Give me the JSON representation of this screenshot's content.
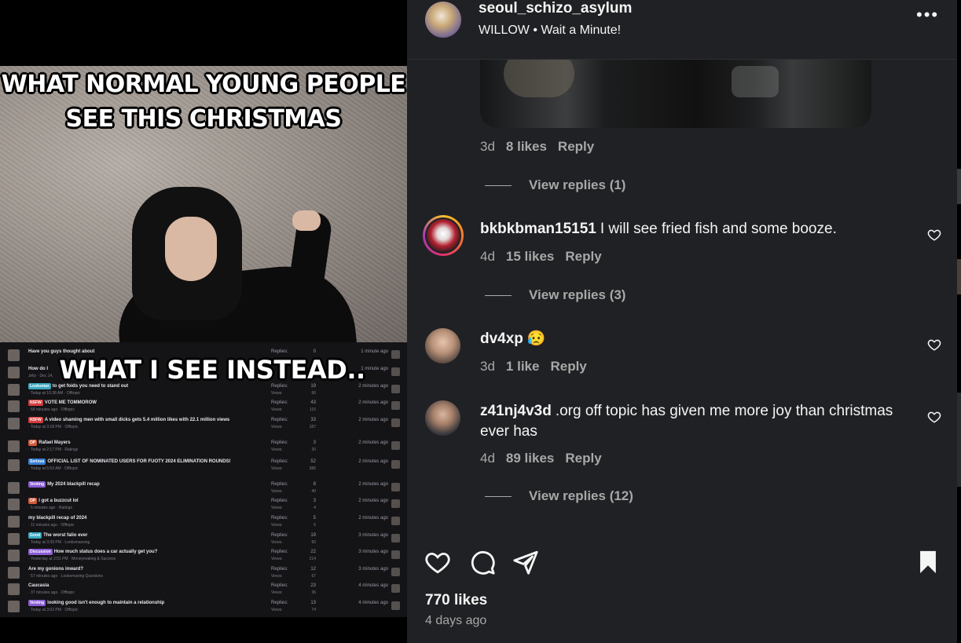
{
  "media": {
    "meme_top_line1": "WHAT NORMAL YOUNG PEOPLE",
    "meme_top_line2": "SEE THIS CHRISTMAS",
    "meme_mid": "WHAT I SEE INSTEAD..",
    "forum_rows": [
      {
        "title": "Have you guys thought about",
        "sub": "",
        "replies": "0",
        "views": "",
        "time": "1 minute ago",
        "user": "",
        "tag": "",
        "tag_color": ""
      },
      {
        "title": "How do I",
        "sub": "Jelly · Dec 14,",
        "replies": "",
        "views": "",
        "time": "1 minute ago",
        "user": "",
        "tag": "",
        "tag_color": ""
      },
      {
        "title": "to get foids you need to stand out",
        "sub": "· Today at 10:38 AM · Offtopic",
        "replies": "19",
        "views": "66",
        "time": "2 minutes ago",
        "user": "",
        "tag": "Looksmax",
        "tag_color": "#3aa8c1"
      },
      {
        "title": "VOTE ME TOMMOROW",
        "sub": "· 58 minutes ago · Offtopic",
        "replies": "43",
        "views": "115",
        "time": "2 minutes ago",
        "user": "",
        "tag": "NSFW",
        "tag_color": "#d43c3c"
      },
      {
        "title": "A video shaming men with small dicks gets 5.4 million likes with 22.1 million views",
        "sub": "· Today at 3:18 PM · Offtopic",
        "replies": "33",
        "views": "187",
        "time": "2 minutes ago",
        "user": "",
        "tag": "NSFW",
        "tag_color": "#d43c3c"
      },
      {
        "title": "Rafael Mayers",
        "sub": "· Today at 2:17 PM · Ratings",
        "replies": "3",
        "views": "20",
        "time": "2 minutes ago",
        "user": "",
        "tag": "OP",
        "tag_color": "#d45a3c"
      },
      {
        "title": "OFFICIAL LIST OF NOMINATED USERS FOR FUOTY 2024 ELIMINATION ROUNDS!",
        "sub": "· Today at 5:53 AM · Offtopic",
        "replies": "52",
        "views": "386",
        "time": "2 minutes ago",
        "user": "",
        "tag": "Serious",
        "tag_color": "#3a7fd4"
      },
      {
        "title": "My 2024 blackpill recap",
        "sub": "",
        "replies": "8",
        "views": "40",
        "time": "2 minutes ago",
        "user": "",
        "tag": "Venting",
        "tag_color": "#8a5cd4"
      },
      {
        "title": "I got a buzzcut lol",
        "sub": "· 5 minutes ago · Ratings",
        "replies": "3",
        "views": "4",
        "time": "2 minutes ago",
        "user": "",
        "tag": "OP",
        "tag_color": "#d45a3c"
      },
      {
        "title": "my blackpill recap of 2024",
        "sub": "· 11 minutes ago · Offtopic",
        "replies": "5",
        "views": "6",
        "time": "2 minutes ago",
        "user": "",
        "tag": "",
        "tag_color": ""
      },
      {
        "title": "The worst falio ever",
        "sub": "· Today at 3:39 PM · Looksmaxxing",
        "replies": "19",
        "views": "60",
        "time": "3 minutes ago",
        "user": "",
        "tag": "Good",
        "tag_color": "#3aa8c1"
      },
      {
        "title": "How much status does a car actually get you?",
        "sub": "· Yesterday at 2:51 PM · Moneymaking & Success",
        "replies": "22",
        "views": "214",
        "time": "3 minutes ago",
        "user": "",
        "tag": "Discussion",
        "tag_color": "#8a5cd4"
      },
      {
        "title": "Are my gonions inward?",
        "sub": "· 57 minutes ago · Looksmaxing Questions",
        "replies": "12",
        "views": "67",
        "time": "3 minutes ago",
        "user": "",
        "tag": "",
        "tag_color": ""
      },
      {
        "title": "Caucasia",
        "sub": "· 37 minutes ago · Offtopic",
        "replies": "23",
        "views": "36",
        "time": "4 minutes ago",
        "user": "",
        "tag": "",
        "tag_color": ""
      },
      {
        "title": "looking good isn't enough to maintain a relationship",
        "sub": "· Today at 3:02 PM · Offtopic",
        "replies": "13",
        "views": "74",
        "time": "4 minutes ago",
        "user": "",
        "tag": "Venting",
        "tag_color": "#8a5cd4"
      }
    ],
    "replies_label": "Replies:",
    "views_label": "Views:"
  },
  "header": {
    "username": "seoul_schizo_asylum",
    "song": "WILLOW • Wait a Minute!",
    "more_icon": "more-horizontal-icon"
  },
  "comments": [
    {
      "user": "",
      "text": "",
      "age": "3d",
      "likes": "8 likes",
      "reply": "Reply",
      "view_replies": "View replies (1)"
    },
    {
      "user": "bkbkbman15151",
      "text": "I will see fried fish and some booze.",
      "age": "4d",
      "likes": "15 likes",
      "reply": "Reply",
      "view_replies": "View replies (3)"
    },
    {
      "user": "dv4xp",
      "text": "😥",
      "age": "3d",
      "likes": "1 like",
      "reply": "Reply",
      "view_replies": ""
    },
    {
      "user": "z41nj4v3d",
      "text": ".org off topic has given me more joy than christmas ever has",
      "age": "4d",
      "likes": "89 likes",
      "reply": "Reply",
      "view_replies": "View replies (12)"
    }
  ],
  "footer": {
    "likes_total": "770 likes",
    "posted": "4 days ago",
    "icons": [
      "heart-icon",
      "comment-icon",
      "share-icon",
      "bookmark-icon"
    ]
  },
  "colors": {
    "panel_bg": "#202124",
    "muted_text": "#a8a8a8",
    "text": "#f5f5f5"
  }
}
